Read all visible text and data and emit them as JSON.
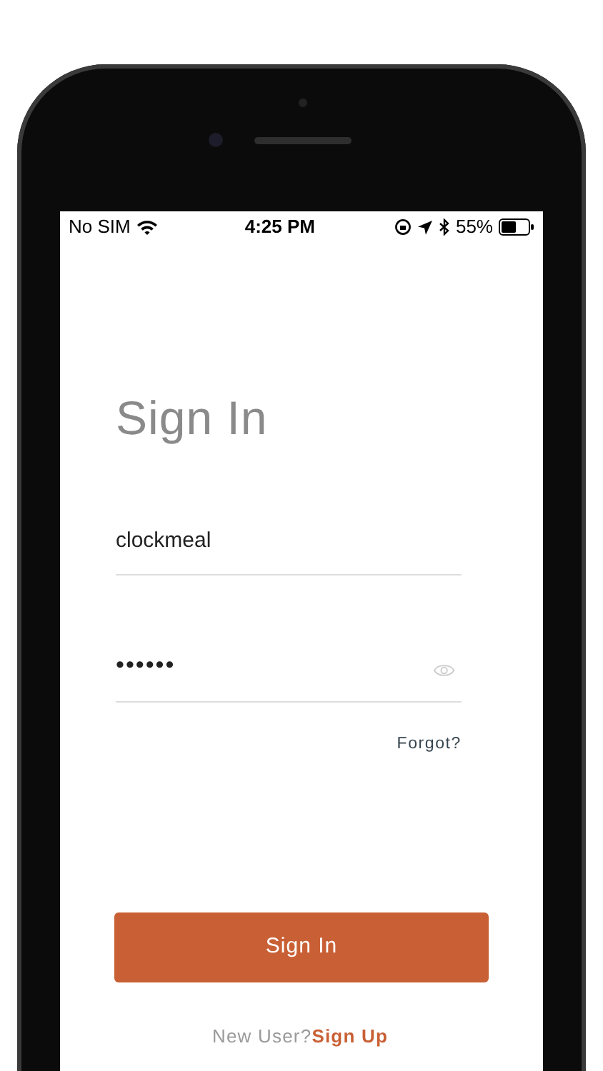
{
  "status_bar": {
    "carrier": "No SIM",
    "time": "4:25 PM",
    "battery": "55%"
  },
  "title": "Sign In",
  "username": {
    "value": "clockmeal"
  },
  "password": {
    "value": "••••••"
  },
  "forgot_link": "Forgot?",
  "sign_in_button": "Sign In",
  "signup_prompt": {
    "text": "New User?",
    "link": "Sign Up"
  }
}
